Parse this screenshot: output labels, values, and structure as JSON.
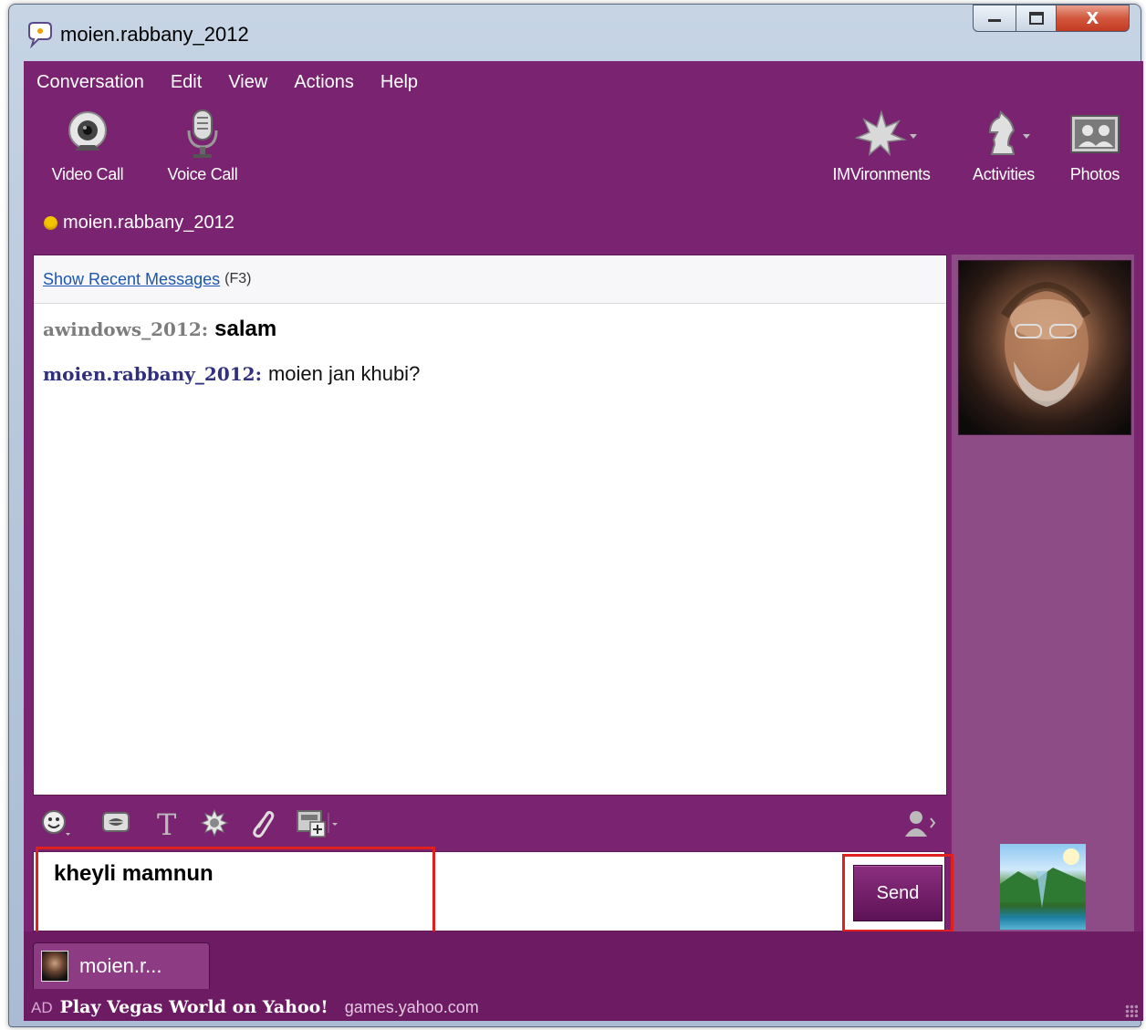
{
  "window": {
    "title": "moien.rabbany_2012",
    "buttons": {
      "minimize": "—",
      "maximize": "☐",
      "close": "X"
    }
  },
  "menu": [
    "Conversation",
    "Edit",
    "View",
    "Actions",
    "Help"
  ],
  "toolbar": {
    "left": [
      {
        "label": "Video Call",
        "icon": "webcam-icon"
      },
      {
        "label": "Voice Call",
        "icon": "microphone-icon"
      }
    ],
    "right": [
      {
        "label": "IMVironments",
        "icon": "leaf-icon"
      },
      {
        "label": "Activities",
        "icon": "chess-knight-icon"
      },
      {
        "label": "Photos",
        "icon": "photos-icon"
      }
    ]
  },
  "status": {
    "contact": "moien.rabbany_2012",
    "dot_color": "#f5c400"
  },
  "conversation": {
    "recent_link": "Show Recent Messages",
    "recent_key": "(F3)",
    "messages": [
      {
        "sender": "awindows_2012:",
        "text": "salam"
      },
      {
        "sender": "moien.rabbany_2012:",
        "text": "moien jan khubi?"
      }
    ]
  },
  "format_toolbar": [
    "emoticon-icon",
    "buzz-lips-icon",
    "text-format-icon",
    "audibles-icon",
    "attach-paperclip-icon",
    "share-image-icon",
    "contacts-icon"
  ],
  "compose": {
    "text": "kheyli mamnun",
    "send_label": "Send"
  },
  "tabs": [
    {
      "label": "moien.r..."
    }
  ],
  "ad": {
    "tag": "AD",
    "title": "Play Vegas World on Yahoo!",
    "url": "games.yahoo.com"
  },
  "colors": {
    "purple": "#7a2471",
    "panel": "#8e4c86",
    "highlight": "#e01f1f"
  }
}
